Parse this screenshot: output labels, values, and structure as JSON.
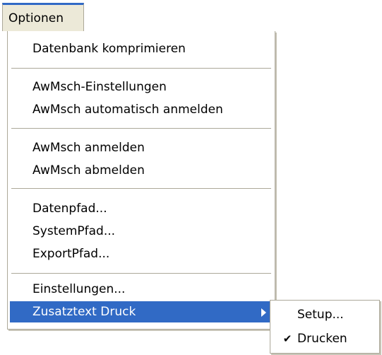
{
  "menubar": {
    "title": "Optionen"
  },
  "menu": {
    "items": [
      {
        "label": "Datenbank komprimieren"
      },
      {
        "label": "AwMsch-Einstellungen"
      },
      {
        "label": "AwMsch automatisch anmelden"
      },
      {
        "label": "AwMsch anmelden"
      },
      {
        "label": "AwMsch abmelden"
      },
      {
        "label": "Datenpfad..."
      },
      {
        "label": "SystemPfad..."
      },
      {
        "label": "ExportPfad..."
      },
      {
        "label": "Einstellungen..."
      },
      {
        "label": "Zusatztext Druck"
      }
    ]
  },
  "submenu": {
    "items": [
      {
        "label": "Setup...",
        "checked": false
      },
      {
        "label": "Drucken",
        "checked": true,
        "check_glyph": "✔"
      }
    ]
  },
  "colors": {
    "highlight": "#316ac5",
    "menubar_accent": "#3169c6",
    "menubar_bg": "#ece9d8",
    "separator": "#aca899"
  }
}
